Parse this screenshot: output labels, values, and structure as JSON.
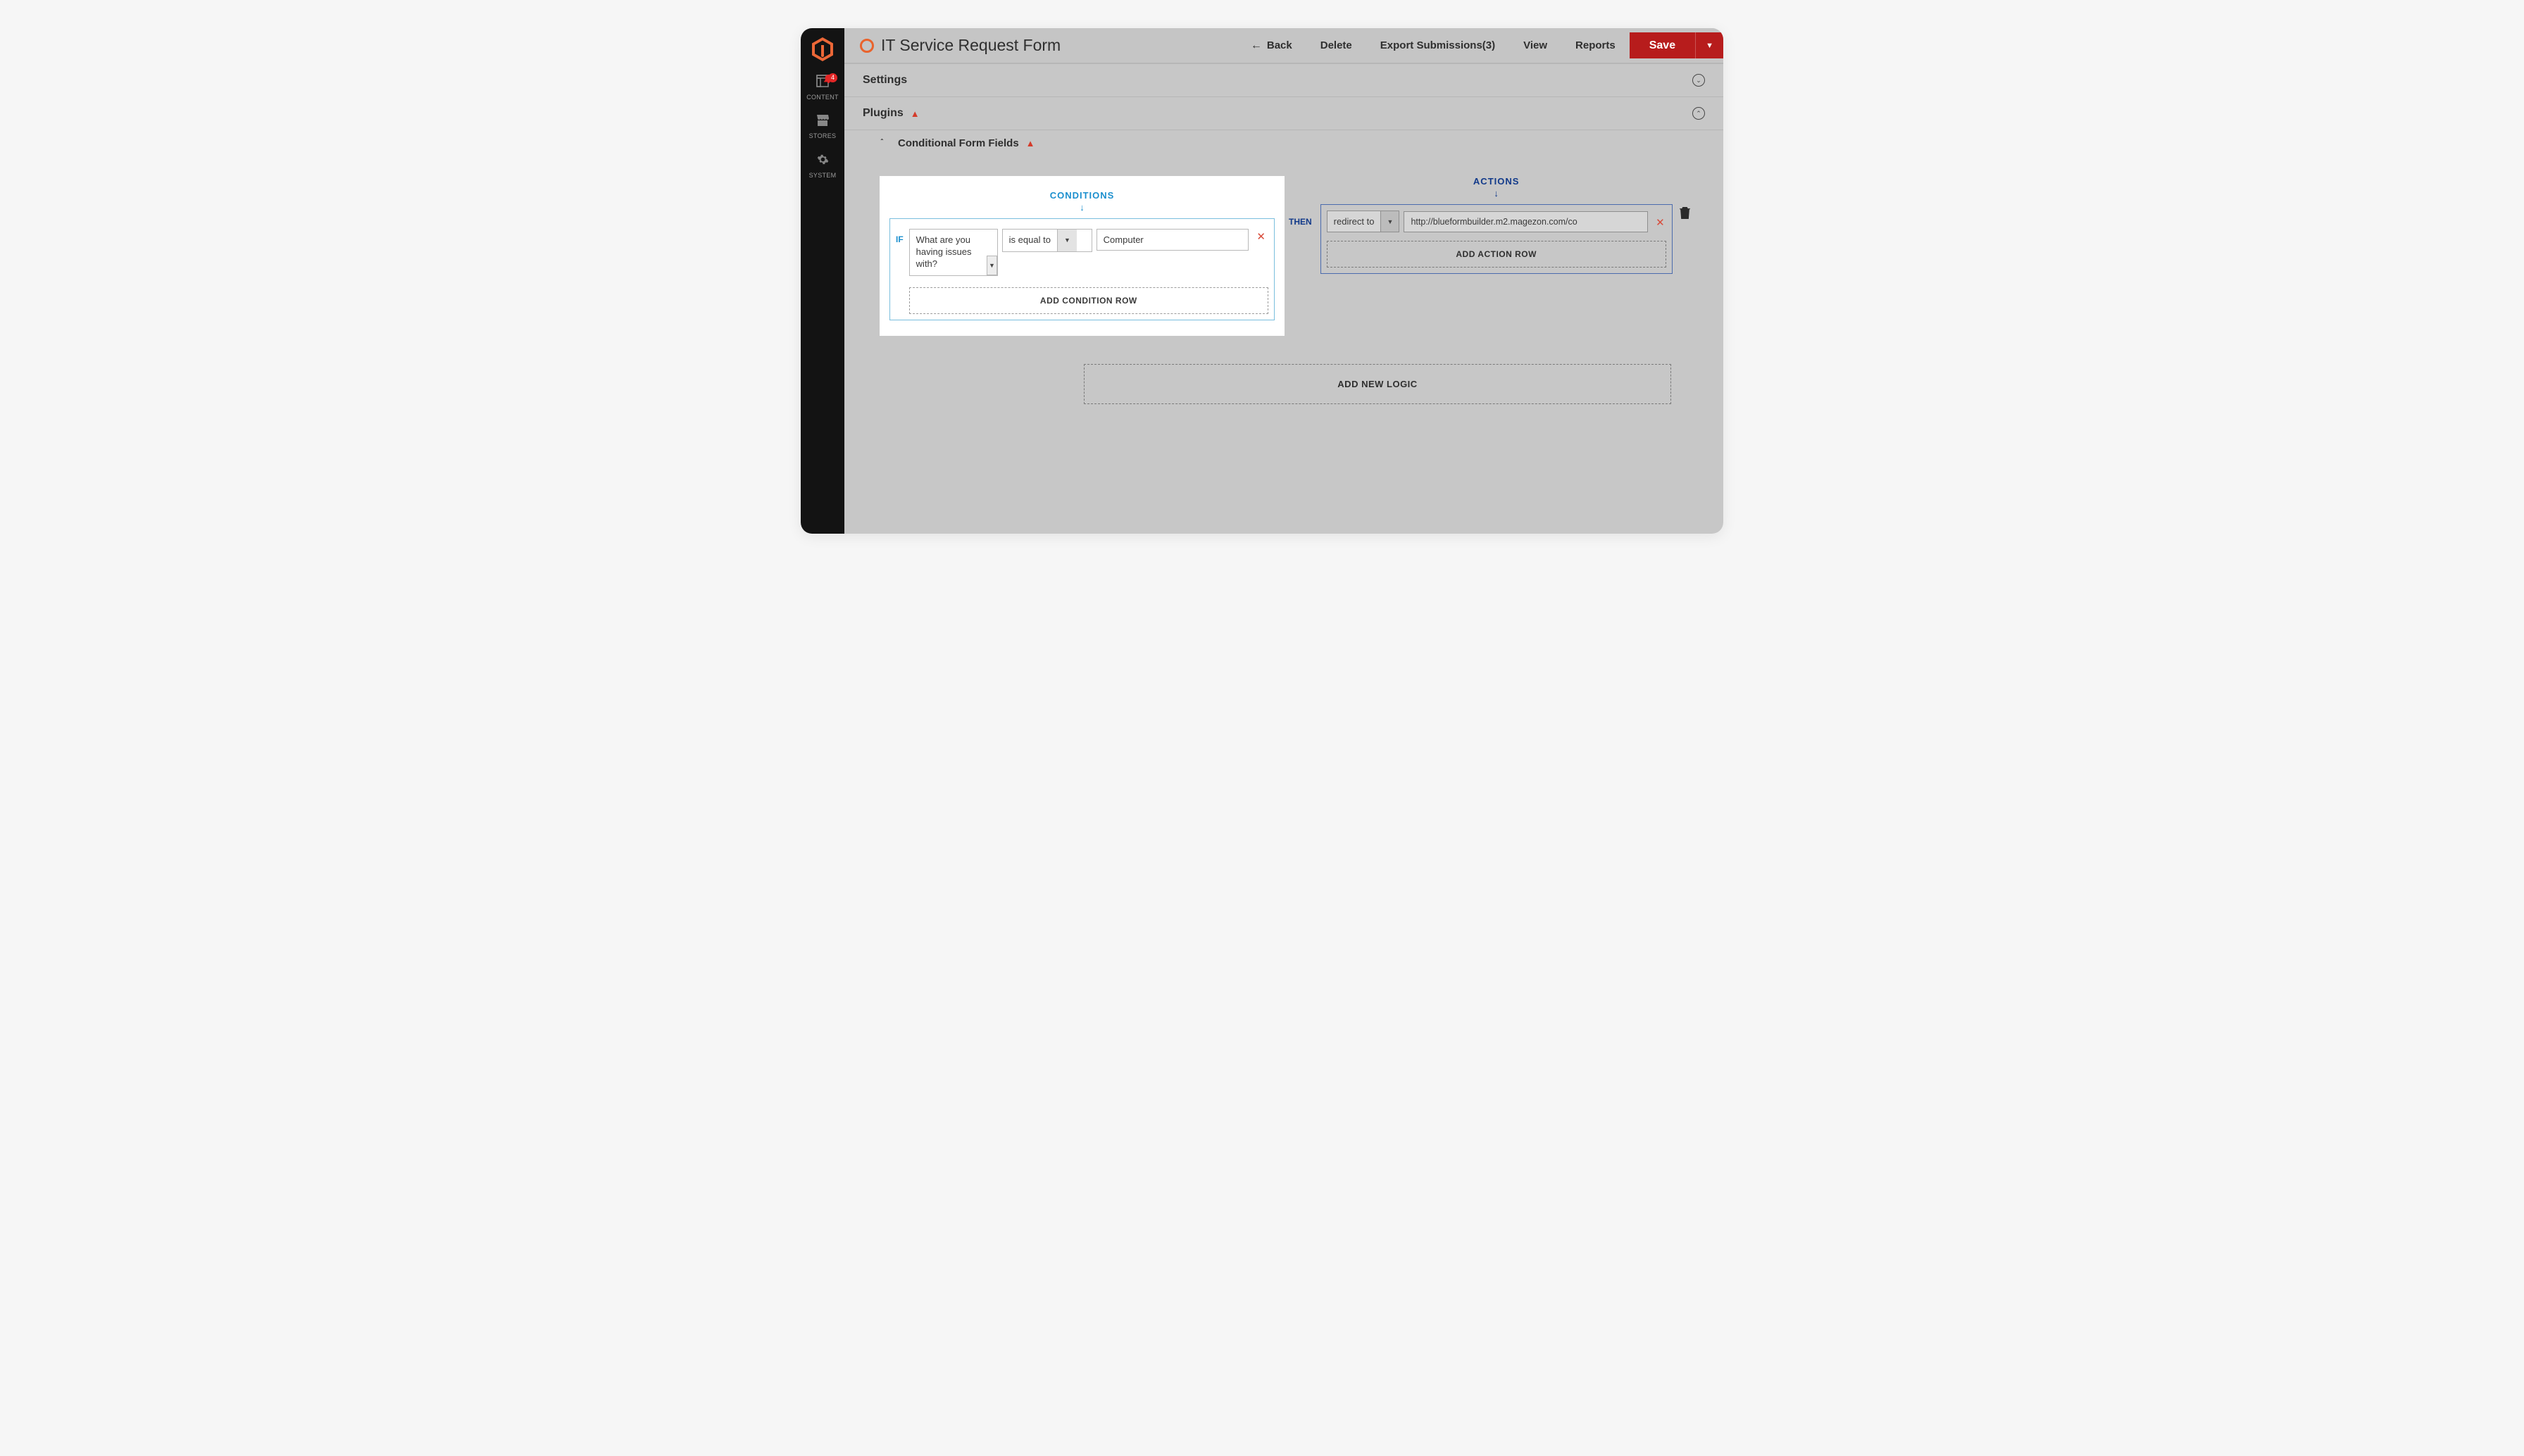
{
  "sidebar": {
    "items": [
      {
        "id": "content",
        "label": "CONTENT",
        "badge": "4"
      },
      {
        "id": "stores",
        "label": "STORES"
      },
      {
        "id": "system",
        "label": "SYSTEM"
      }
    ]
  },
  "header": {
    "title": "IT Service Request Form",
    "back": "Back",
    "delete": "Delete",
    "export": "Export Submissions(3)",
    "view": "View",
    "reports": "Reports",
    "save": "Save"
  },
  "sections": {
    "settings": "Settings",
    "plugins": "Plugins",
    "conditional": "Conditional Form Fields"
  },
  "logic": {
    "conditions_header": "CONDITIONS",
    "actions_header": "ACTIONS",
    "if_label": "IF",
    "then_label": "THEN",
    "add_condition": "ADD CONDITION ROW",
    "add_action": "ADD ACTION ROW",
    "add_logic": "ADD NEW LOGIC",
    "condition": {
      "field": "What are you having issues with?",
      "operator": "is equal to",
      "value": "Computer"
    },
    "action": {
      "type": "redirect to",
      "value": "http://blueformbuilder.m2.magezon.com/co"
    }
  }
}
